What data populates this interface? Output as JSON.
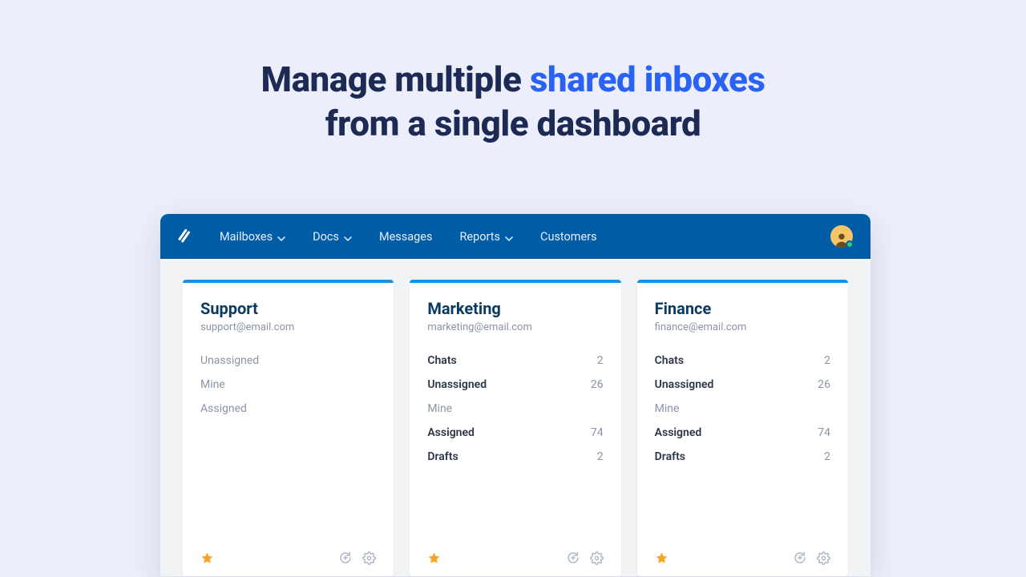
{
  "hero": {
    "line1_pre": "Manage multiple ",
    "line1_accent": "shared inboxes",
    "line2": "from a single dashboard"
  },
  "nav": {
    "items": [
      {
        "label": "Mailboxes",
        "has_dropdown": true
      },
      {
        "label": "Docs",
        "has_dropdown": true
      },
      {
        "label": "Messages",
        "has_dropdown": false
      },
      {
        "label": "Reports",
        "has_dropdown": true
      },
      {
        "label": "Customers",
        "has_dropdown": false
      }
    ]
  },
  "inboxes": [
    {
      "title": "Support",
      "email": "support@email.com",
      "rows": [
        {
          "label": "Unassigned",
          "count": "",
          "bold": false
        },
        {
          "label": "Mine",
          "count": "",
          "bold": false
        },
        {
          "label": "Assigned",
          "count": "",
          "bold": false
        }
      ]
    },
    {
      "title": "Marketing",
      "email": "marketing@email.com",
      "rows": [
        {
          "label": "Chats",
          "count": "2",
          "bold": true
        },
        {
          "label": "Unassigned",
          "count": "26",
          "bold": true
        },
        {
          "label": "Mine",
          "count": "",
          "bold": false
        },
        {
          "label": "Assigned",
          "count": "74",
          "bold": true
        },
        {
          "label": "Drafts",
          "count": "2",
          "bold": true
        }
      ]
    },
    {
      "title": "Finance",
      "email": "finance@email.com",
      "rows": [
        {
          "label": "Chats",
          "count": "2",
          "bold": true
        },
        {
          "label": "Unassigned",
          "count": "26",
          "bold": true
        },
        {
          "label": "Mine",
          "count": "",
          "bold": false
        },
        {
          "label": "Assigned",
          "count": "74",
          "bold": true
        },
        {
          "label": "Drafts",
          "count": "2",
          "bold": true
        }
      ]
    }
  ],
  "colors": {
    "brand_blue": "#005ca4",
    "accent_top": "#1292ee",
    "hero_accent": "#2a62f5",
    "hero_dark": "#1c2a54"
  }
}
